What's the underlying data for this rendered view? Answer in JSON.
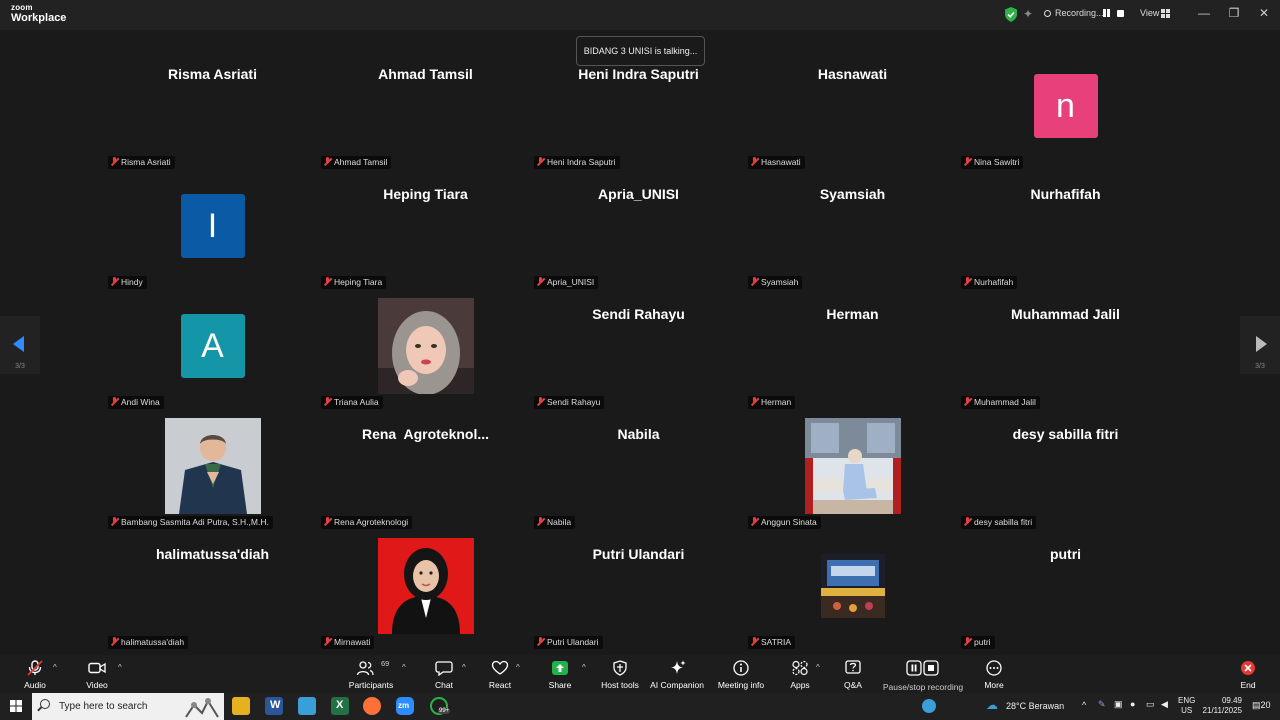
{
  "app": {
    "brand_top": "zoom",
    "brand_bottom": "Workplace"
  },
  "titlebar": {
    "recording_label": "Recording...",
    "view_label": "View",
    "minimize": "—",
    "restore": "❐",
    "close": "✕"
  },
  "talking_banner": "BIDANG 3 UNISI is talking...",
  "pager": {
    "left": "3/3",
    "right": "3/3"
  },
  "participants": [
    {
      "display": "Risma Asriati",
      "label": "Risma Asriati"
    },
    {
      "display": "Ahmad Tamsil",
      "label": "Ahmad Tamsil"
    },
    {
      "display": "Heni Indra Saputri",
      "label": "Heni Indra Saputri"
    },
    {
      "display": "Hasnawati",
      "label": "Hasnawati"
    },
    {
      "display": "",
      "label": "Nina Sawitri",
      "avatar": "n",
      "avatar_color": "#e8407a"
    },
    {
      "display": "",
      "label": "Hindy",
      "avatar": "I",
      "avatar_color": "#0b5aa6"
    },
    {
      "display": "Heping Tiara",
      "label": "Heping Tiara"
    },
    {
      "display": "Apria_UNISI",
      "label": "Apria_UNISI"
    },
    {
      "display": "Syamsiah",
      "label": "Syamsiah"
    },
    {
      "display": "Nurhafifah",
      "label": "Nurhafifah"
    },
    {
      "display": "",
      "label": "Andi Wina",
      "avatar": "A",
      "avatar_color": "#1596a8"
    },
    {
      "display": "",
      "label": "Triana Aulia",
      "photo": "woman-hijab-selfie"
    },
    {
      "display": "Sendi Rahayu",
      "label": "Sendi Rahayu"
    },
    {
      "display": "Herman",
      "label": "Herman"
    },
    {
      "display": "Muhammad Jalil",
      "label": "Muhammad Jalil"
    },
    {
      "display": "",
      "label": "Bambang Sasmita Adi Putra, S.H.,M.H.",
      "photo": "man-suit"
    },
    {
      "display": "Rena  Agroteknol...",
      "label": "Rena Agroteknologi"
    },
    {
      "display": "Nabila",
      "label": "Nabila"
    },
    {
      "display": "",
      "label": "Anggun Sinata",
      "photo": "woman-sitting-bench"
    },
    {
      "display": "desy sabilla fitri",
      "label": "desy sabilla fitri"
    },
    {
      "display": "halimatussa'diah",
      "label": "halimatussa'diah"
    },
    {
      "display": "",
      "label": "Mirnawati",
      "photo": "woman-red-background"
    },
    {
      "display": "Putri Ulandari",
      "label": "Putri Ulandari"
    },
    {
      "display": "",
      "label": "SATRIA",
      "photo": "stage-night"
    },
    {
      "display": "putri",
      "label": "putri"
    }
  ],
  "toolbar": {
    "audio": "Audio",
    "video": "Video",
    "participants": "Participants",
    "participants_count": "69",
    "chat": "Chat",
    "react": "React",
    "share": "Share",
    "host_tools": "Host tools",
    "ai_companion": "AI Companion",
    "meeting_info": "Meeting info",
    "apps": "Apps",
    "qa": "Q&A",
    "pause_stop": "Pause/stop recording",
    "more": "More",
    "end": "End"
  },
  "taskbar": {
    "search_placeholder": "Type here to search",
    "weather": "28°C  Berawan",
    "lang_top": "ENG",
    "lang_bottom": "US",
    "time": "09.49",
    "date": "21/11/2025",
    "notif_count": "20",
    "whatsapp_badge": "99+"
  },
  "colors": {
    "accent_green": "#22b14c",
    "shield_green": "#2db34a",
    "end_red": "#e53935",
    "arrow_blue": "#2d8cff"
  }
}
